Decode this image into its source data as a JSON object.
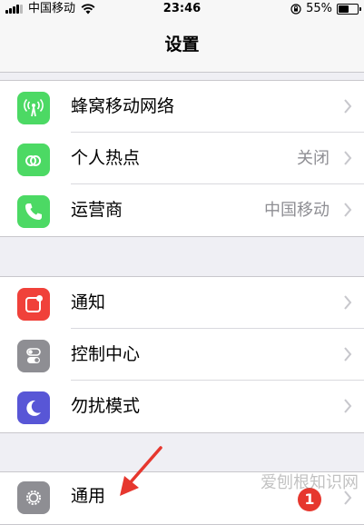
{
  "status_bar": {
    "carrier": "中国移动",
    "time": "23:46",
    "battery": "55%",
    "battery_level": 0.55,
    "icons": [
      "signal-icon",
      "wifi-icon",
      "rotation-lock-icon",
      "battery-icon"
    ]
  },
  "nav": {
    "title": "设置"
  },
  "groups": [
    {
      "items": [
        {
          "label": "蜂窝移动网络",
          "value": "",
          "icon": "cellular-icon",
          "color": "#4cd964"
        },
        {
          "label": "个人热点",
          "value": "关闭",
          "icon": "hotspot-icon",
          "color": "#4cd964"
        },
        {
          "label": "运营商",
          "value": "中国移动",
          "icon": "phone-icon",
          "color": "#4cd964"
        }
      ]
    },
    {
      "items": [
        {
          "label": "通知",
          "value": "",
          "icon": "notifications-icon",
          "color": "#f0413a"
        },
        {
          "label": "控制中心",
          "value": "",
          "icon": "control-center-icon",
          "color": "#8e8e93"
        },
        {
          "label": "勿扰模式",
          "value": "",
          "icon": "moon-icon",
          "color": "#5856d6"
        }
      ]
    },
    {
      "items": [
        {
          "label": "通用",
          "value": "",
          "icon": "gear-icon",
          "color": "#8e8e93",
          "badge": "1"
        }
      ]
    }
  ],
  "annotation": {
    "arrow_color": "#e6372e"
  },
  "watermark": "爱刨根知识网"
}
